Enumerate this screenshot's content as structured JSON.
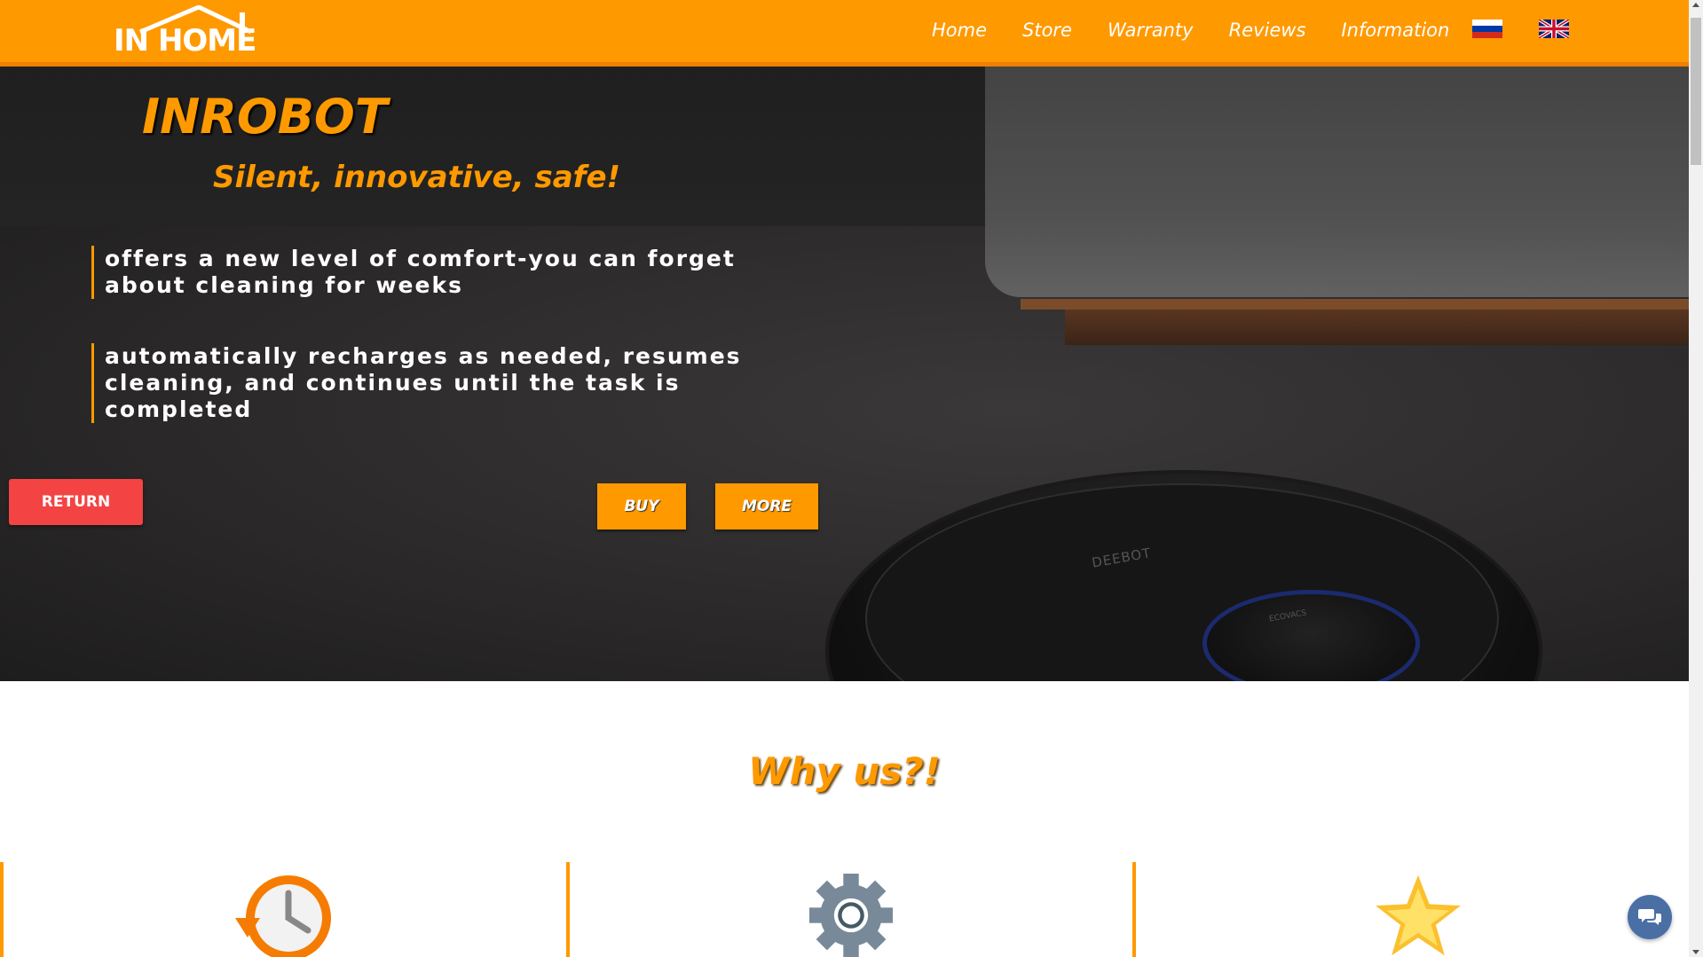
{
  "header": {
    "logo_text": "IN HOME",
    "nav": [
      "Home",
      "Store",
      "Warranty",
      "Reviews",
      "Information"
    ],
    "languages": [
      "russian-flag",
      "uk-flag"
    ],
    "colors": {
      "brand": "#ff9900",
      "accent_border": "#f07f00"
    }
  },
  "hero": {
    "title": "INROBOT",
    "subtitle": "Silent, innovative, safe!",
    "features": [
      "offers a new level of comfort-you can forget about cleaning for weeks",
      "automatically recharges as needed, resumes cleaning, and continues until the task is completed"
    ],
    "buttons": {
      "buy": "BUY",
      "more": "MORE"
    },
    "robot_label": "DEEBOT",
    "robot_brand": "ECOVACS"
  },
  "return_button": {
    "label": "RETURN",
    "color": "#f44343"
  },
  "why": {
    "title": "Why us?!",
    "icons": [
      "history-clock-icon",
      "gear-icon",
      "star-icon"
    ]
  },
  "chat": {
    "icon": "chat-bubbles-icon",
    "color": "#4a6fa5"
  }
}
